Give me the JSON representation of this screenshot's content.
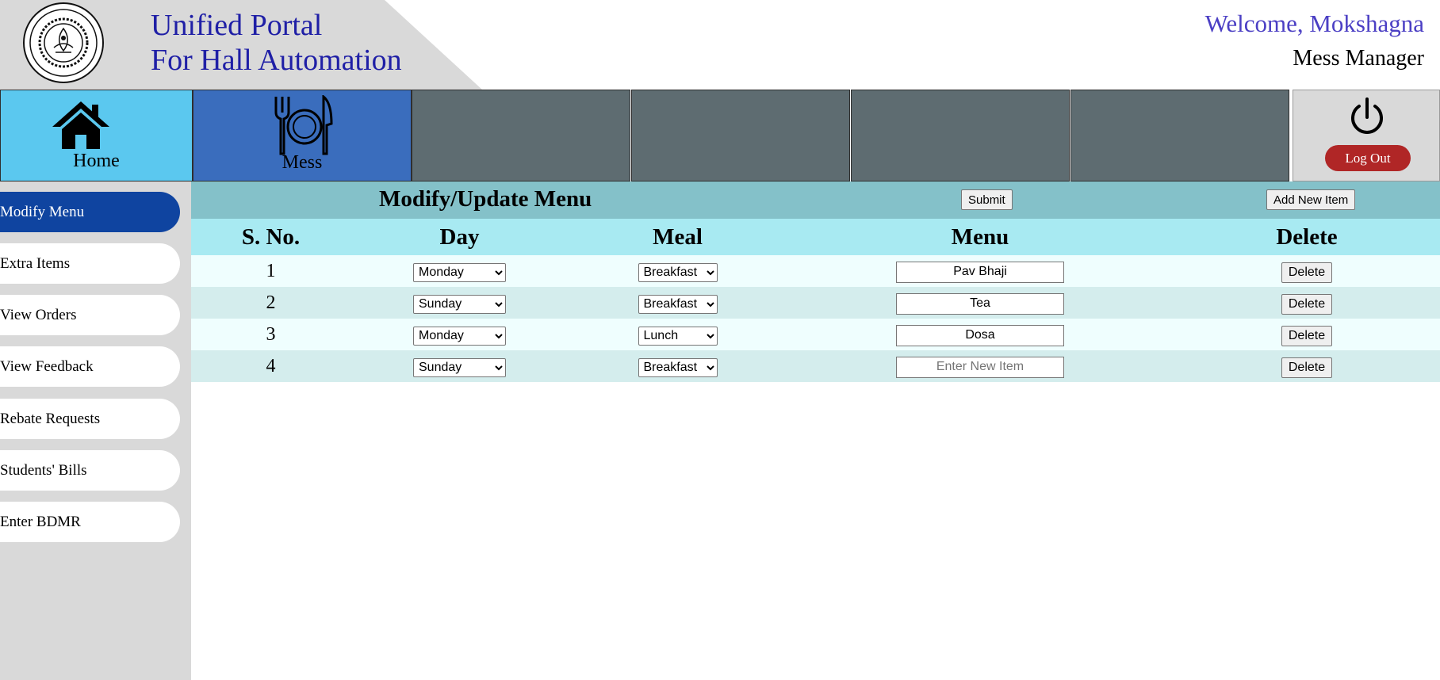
{
  "header": {
    "portal_title_line1": "Unified Portal",
    "portal_title_line2": "For Hall Automation",
    "welcome_text": "Welcome, Mokshagna",
    "role_text": "Mess Manager",
    "logo_icon": "iit-kanpur-seal-icon",
    "logo_text": "भारतीय प्रौद्योगिकी संस्थान कानपुर · INDIAN INSTITUTE OF TECHNOLOGY KANPUR"
  },
  "nav": {
    "home_label": "Home",
    "mess_label": "Mess",
    "logout_label": "Log Out",
    "home_icon": "home-icon",
    "mess_icon": "fork-plate-knife-icon",
    "power_icon": "power-icon",
    "colors": {
      "home": "#5bc8ef",
      "mess": "#3a6dbd",
      "empty": "#5e6c71",
      "logout": "#b02626"
    }
  },
  "sidebar": {
    "items": [
      {
        "label": "Modify Menu",
        "active": true
      },
      {
        "label": "Extra Items",
        "active": false
      },
      {
        "label": "View Orders",
        "active": false
      },
      {
        "label": "View Feedback",
        "active": false
      },
      {
        "label": "Rebate Requests",
        "active": false
      },
      {
        "label": "Students' Bills",
        "active": false
      },
      {
        "label": "Enter BDMR",
        "active": false
      }
    ]
  },
  "main": {
    "title": "Modify/Update Menu",
    "submit_label": "Submit",
    "add_item_label": "Add New Item",
    "columns": [
      "S. No.",
      "Day",
      "Meal",
      "Menu",
      "Delete"
    ],
    "rows": [
      {
        "sno": "1",
        "day": "Monday",
        "meal": "Breakfast",
        "menu": "Pav Bhaji",
        "placeholder": "",
        "delete": "Delete"
      },
      {
        "sno": "2",
        "day": "Sunday",
        "meal": "Breakfast",
        "menu": "Tea",
        "placeholder": "",
        "delete": "Delete"
      },
      {
        "sno": "3",
        "day": "Monday",
        "meal": "Lunch",
        "menu": "Dosa",
        "placeholder": "",
        "delete": "Delete"
      },
      {
        "sno": "4",
        "day": "Sunday",
        "meal": "Breakfast",
        "menu": "",
        "placeholder": "Enter New Item",
        "delete": "Delete"
      }
    ]
  }
}
